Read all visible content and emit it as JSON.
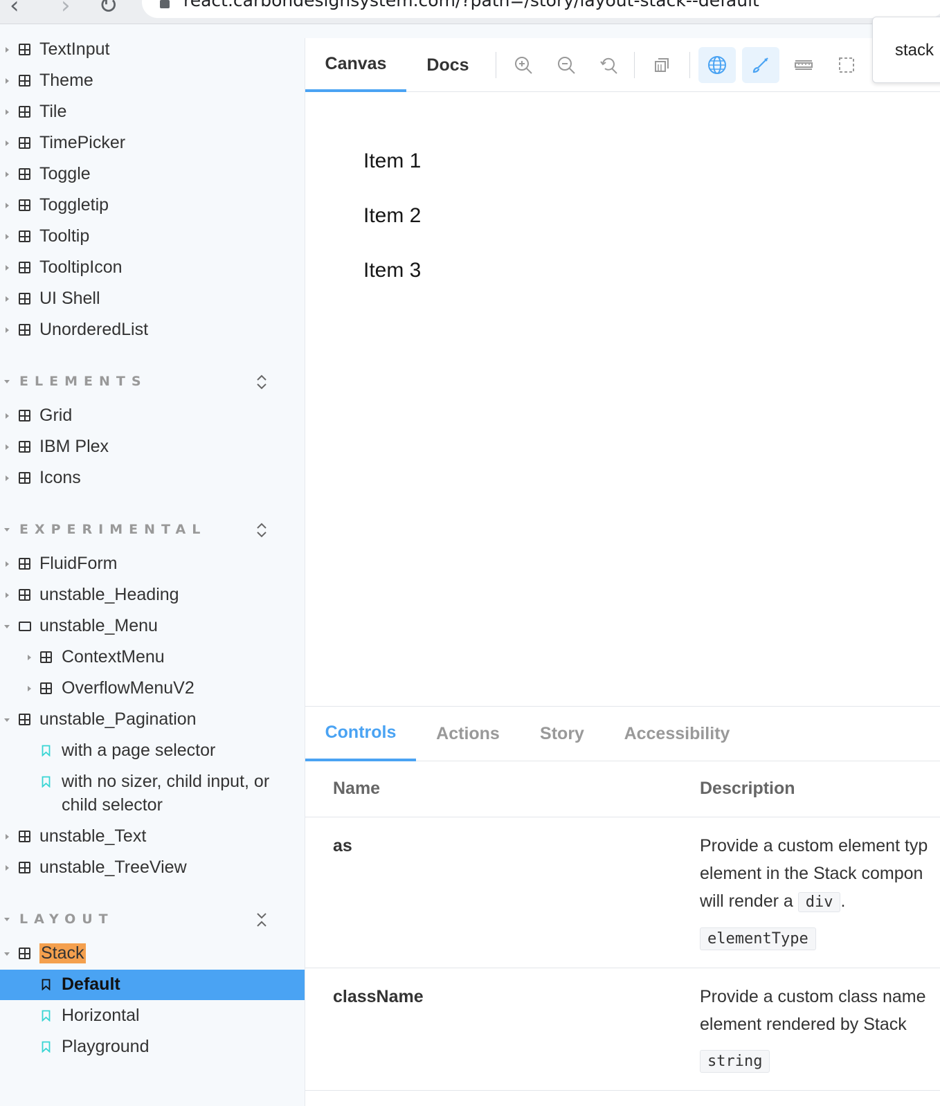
{
  "browser": {
    "url": "react.carbondesignsystem.com/?path=/story/layout-stack--default"
  },
  "sidebar": {
    "top_items": [
      "TextInput",
      "Theme",
      "Tile",
      "TimePicker",
      "Toggle",
      "Toggletip",
      "Tooltip",
      "TooltipIcon",
      "UI Shell",
      "UnorderedList"
    ],
    "elements": {
      "title": "ELEMENTS",
      "items": [
        "Grid",
        "IBM Plex",
        "Icons"
      ]
    },
    "experimental": {
      "title": "EXPERIMENTAL",
      "items": [
        "FluidForm",
        "unstable_Heading",
        "unstable_Menu",
        "ContextMenu",
        "OverflowMenuV2",
        "unstable_Pagination",
        "with a page selector",
        "with no sizer, child input, or",
        "child selector",
        "unstable_Text",
        "unstable_TreeView"
      ]
    },
    "layout": {
      "title": "LAYOUT",
      "items": [
        "Stack",
        "Default",
        "Horizontal",
        "Playground"
      ]
    }
  },
  "toolbar": {
    "tabs": [
      "Canvas",
      "Docs"
    ],
    "popover": "stack"
  },
  "canvas": {
    "items": [
      "Item 1",
      "Item 2",
      "Item 3"
    ]
  },
  "addons": {
    "tabs": [
      "Controls",
      "Actions",
      "Story",
      "Accessibility"
    ],
    "columns": [
      "Name",
      "Description"
    ],
    "rows": [
      {
        "name": "as",
        "desc_lines": [
          "Provide a custom element typ",
          "element in the Stack compon",
          "will render a"
        ],
        "code": "div",
        "desc_end": ".",
        "type": "elementType"
      },
      {
        "name": "className",
        "desc_lines": [
          "Provide a custom class name",
          "element rendered by Stack"
        ],
        "type": "string"
      }
    ]
  },
  "colors": {
    "accent": "#4aa3f3",
    "highlight": "#f4a04e",
    "bookmark": "#37d5d3"
  }
}
